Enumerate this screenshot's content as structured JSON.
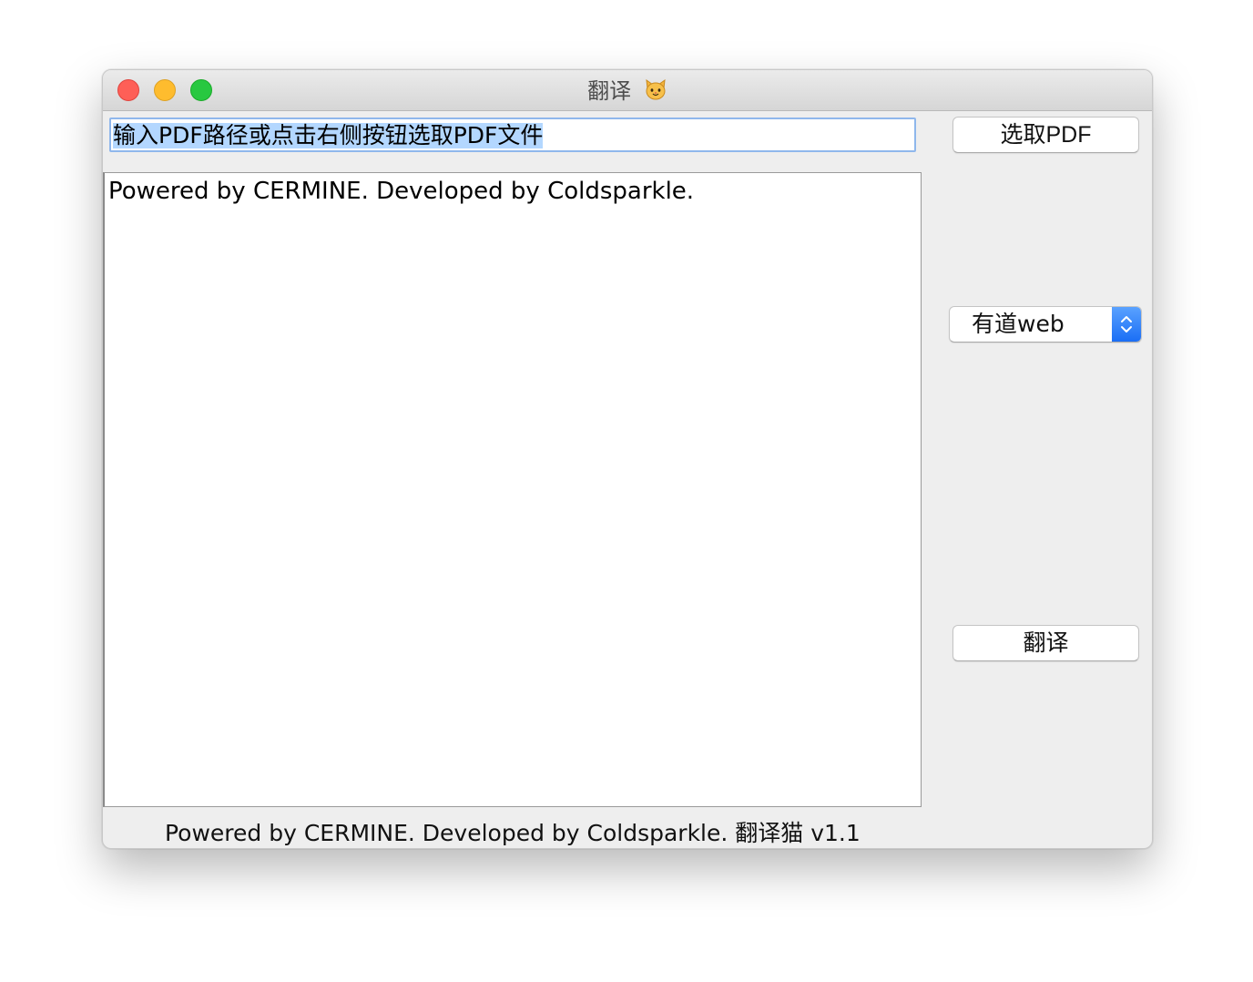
{
  "window": {
    "title": "翻译",
    "title_icon": "cat-face-icon"
  },
  "input": {
    "path_value": "输入PDF路径或点击右侧按钮选取PDF文件"
  },
  "output": {
    "text": "Powered by CERMINE. Developed by Coldsparkle."
  },
  "controls": {
    "pick_pdf_label": "选取PDF",
    "engine_selected": "有道web",
    "translate_label": "翻译"
  },
  "footer": {
    "status_text": "Powered by CERMINE. Developed by Coldsparkle. 翻译猫 v1.1"
  },
  "colors": {
    "selection_highlight": "#b3d7ff",
    "select_arrow_blue": "#1a6ef5",
    "close": "#fe5f57",
    "minimize": "#febc2e",
    "maximize": "#28c840"
  }
}
